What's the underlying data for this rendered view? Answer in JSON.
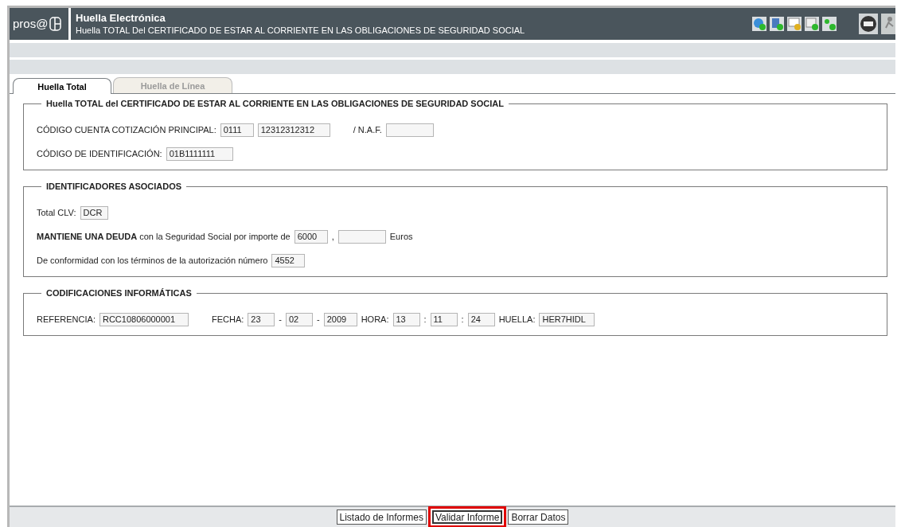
{
  "header": {
    "logo": "pros@",
    "title": "Huella Electrónica",
    "subtitle": "Huella TOTAL Del CERTIFICADO DE ESTAR AL CORRIENTE EN LAS OBLIGACIONES DE SEGURIDAD SOCIAL"
  },
  "tabs": [
    {
      "label": "Huella Total",
      "selected": true
    },
    {
      "label": "Huella de Línea",
      "selected": false
    }
  ],
  "sections": [
    {
      "legend": "Huella TOTAL del CERTIFICADO DE ESTAR AL CORRIENTE EN LAS OBLIGACIONES DE SEGURIDAD SOCIAL",
      "lines": [
        {
          "items": [
            {
              "kind": "label",
              "text": "CÓDIGO CUENTA COTIZACIÓN PRINCIPAL:"
            },
            {
              "kind": "field",
              "value": "0111"
            },
            {
              "kind": "field",
              "value": "12312312312"
            },
            {
              "kind": "label",
              "text": "/ N.A.F.",
              "gap": true
            },
            {
              "kind": "field"
            }
          ]
        },
        {
          "items": [
            {
              "kind": "label",
              "text": "CÓDIGO DE IDENTIFICACIÓN:"
            },
            {
              "kind": "field",
              "value": "01B1111111"
            }
          ]
        }
      ]
    },
    {
      "legend": "IDENTIFICADORES ASOCIADOS",
      "lines": [
        {
          "items": [
            {
              "kind": "label",
              "text": "Total CLV:"
            },
            {
              "kind": "field",
              "value": "DCR"
            }
          ]
        },
        {
          "items": [
            {
              "kind": "label",
              "text": "**MANTIENE UNA DEUDA** con la Seguridad Social por importe de"
            },
            {
              "kind": "field",
              "value": "6000"
            },
            {
              "kind": "label",
              "text": ","
            },
            {
              "kind": "field"
            },
            {
              "kind": "label",
              "text": "Euros"
            }
          ]
        },
        {
          "items": [
            {
              "kind": "label",
              "text": "De conformidad con los términos de la autorización número"
            },
            {
              "kind": "field",
              "value": "4552"
            }
          ]
        }
      ]
    },
    {
      "legend": "CODIFICACIONES INFORMÁTICAS",
      "lines": [
        {
          "items": [
            {
              "kind": "label",
              "text": "REFERENCIA:"
            },
            {
              "kind": "field",
              "value": "RCC10806000001"
            },
            {
              "kind": "label",
              "text": "FECHA:",
              "gap": true
            },
            {
              "kind": "field",
              "value": "23"
            },
            {
              "kind": "label",
              "text": "-"
            },
            {
              "kind": "field",
              "value": "02"
            },
            {
              "kind": "label",
              "text": "-"
            },
            {
              "kind": "field",
              "value": "2009"
            },
            {
              "kind": "label",
              "text": "HORA:"
            },
            {
              "kind": "field",
              "value": "13"
            },
            {
              "kind": "label",
              "text": ":"
            },
            {
              "kind": "field",
              "value": "11"
            },
            {
              "kind": "label",
              "text": ":"
            },
            {
              "kind": "field",
              "value": "24"
            },
            {
              "kind": "label",
              "text": "HUELLA:"
            },
            {
              "kind": "field",
              "value": "HER7HIDL"
            }
          ]
        }
      ]
    }
  ],
  "buttons": [
    {
      "label": "Listado de Informes",
      "highlighted": false
    },
    {
      "label": "Validar Informe",
      "highlighted": true
    },
    {
      "label": "Borrar Datos",
      "highlighted": false
    }
  ]
}
